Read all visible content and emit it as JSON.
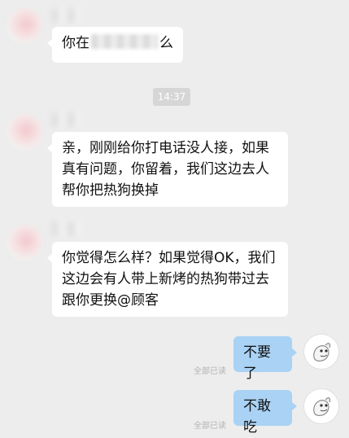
{
  "chat": {
    "messages": [
      {
        "sender": "other",
        "text_before": "你在",
        "text_after": "么"
      },
      {
        "sender": "other",
        "lines": [
          "亲，刚刚给你打电话没人接，如果",
          "真有问题，你留着，我们这边去人",
          "帮你把热狗换掉"
        ]
      },
      {
        "sender": "other",
        "lines": [
          "你觉得怎么样？如果觉得OK，我们",
          "这边会有人带上新烤的热狗带过去",
          "跟你更换@顾客"
        ]
      },
      {
        "sender": "me",
        "text": "不要了",
        "read_status": "全部已读"
      },
      {
        "sender": "me",
        "text": "不敢吃",
        "read_status": "全部已读"
      }
    ],
    "timestamp": "14:37"
  },
  "colors": {
    "background": "#ededed",
    "incoming_bubble": "#ffffff",
    "outgoing_bubble": "#a9d2f5"
  }
}
